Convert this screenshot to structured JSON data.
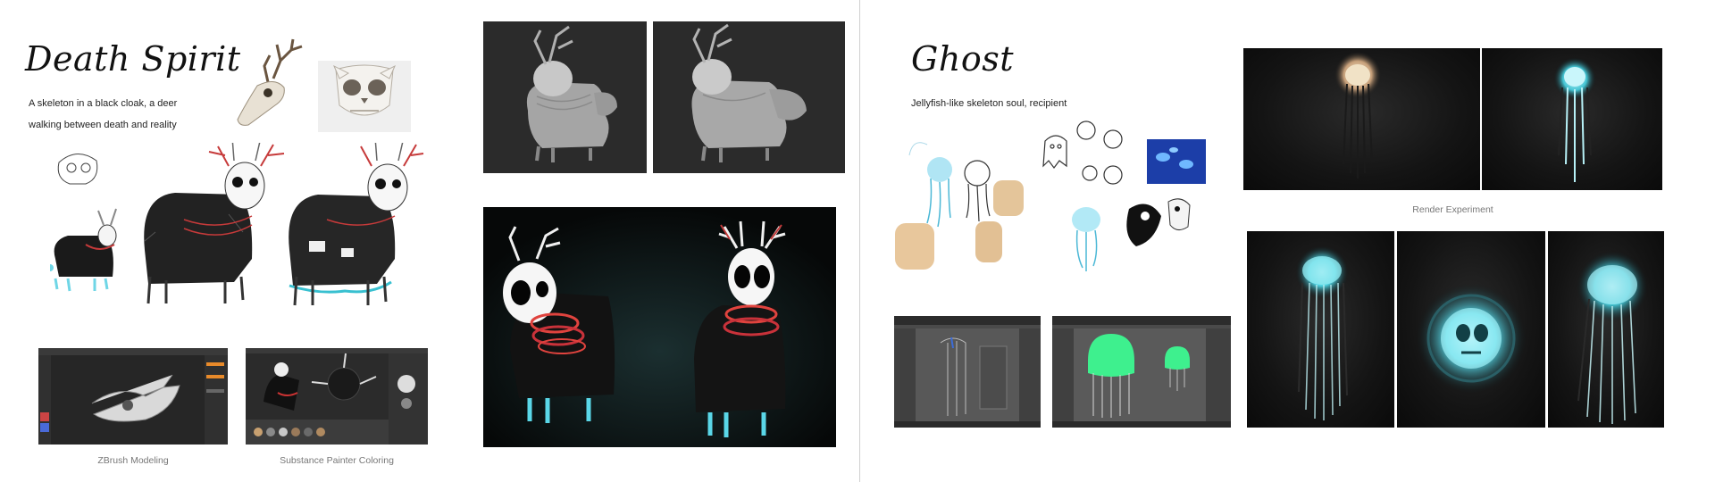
{
  "left": {
    "title": "Death Spirit",
    "description_line1": "A skeleton in a black cloak, a deer",
    "description_line2": "walking between death and reality",
    "captions": {
      "zbrush": "ZBrush Modeling",
      "substance": "Substance Painter Coloring"
    }
  },
  "right": {
    "title": "Ghost",
    "description": "Jellyfish-like skeleton soul, recipient",
    "captions": {
      "render": "Render Experiment"
    }
  },
  "colors": {
    "accent_red": "#d23a3a",
    "accent_cyan": "#5ad7e8",
    "glow_cyan": "#7ff2ff",
    "modeling_gray": "#2d2d2d"
  }
}
